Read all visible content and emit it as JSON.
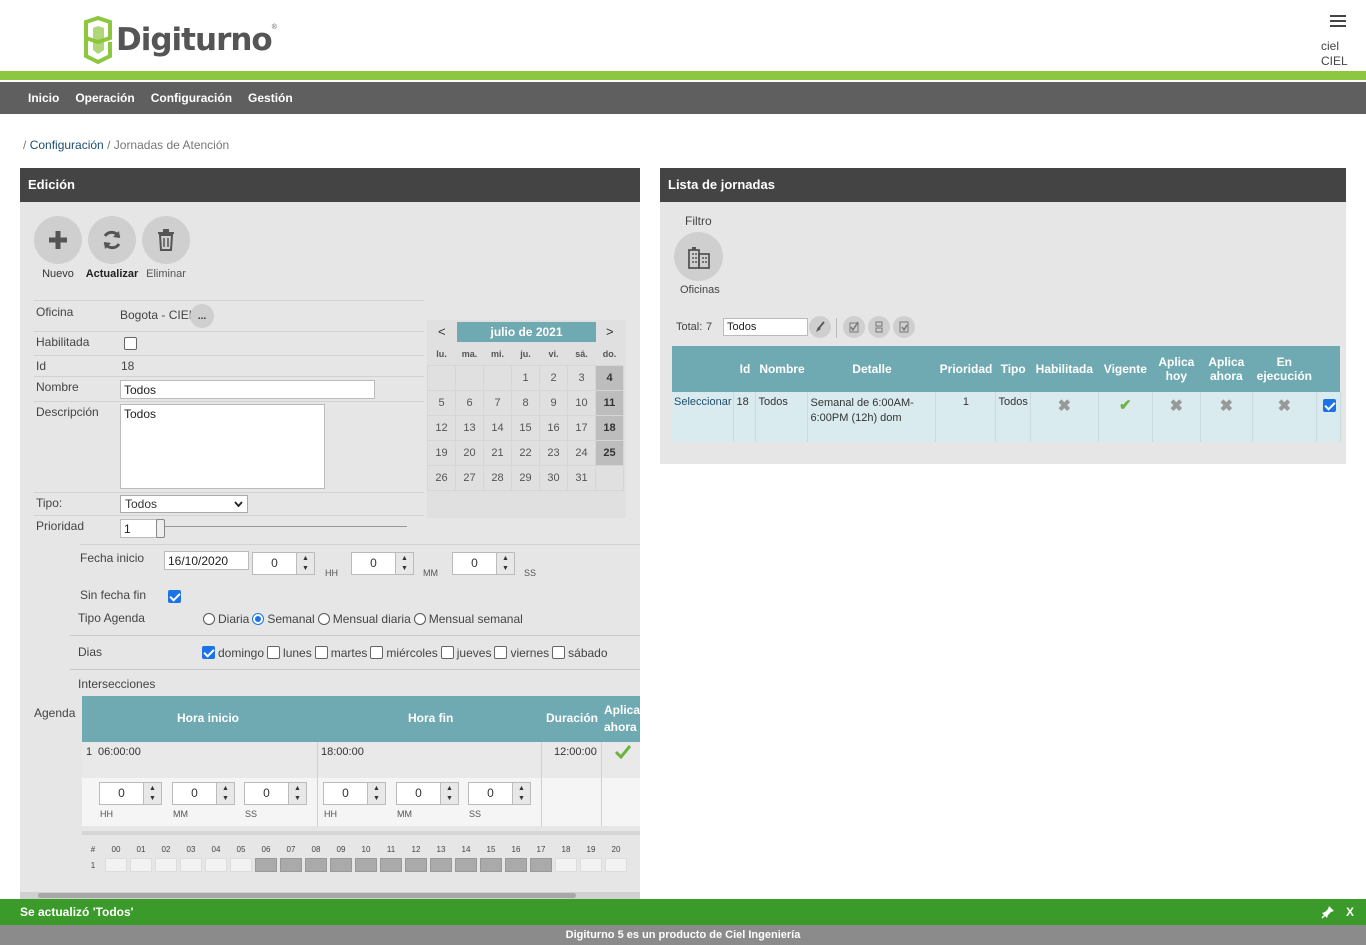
{
  "app": {
    "logo_text": "Digiturno",
    "logo_mark": "®"
  },
  "user": {
    "short": "ciel",
    "long": "CIEL"
  },
  "nav": {
    "items": [
      "Inicio",
      "Operación",
      "Configuración",
      "Gestión"
    ]
  },
  "breadcrumb": {
    "sep": "/",
    "parent": "Configuración",
    "current": "Jornadas de Atención"
  },
  "edit": {
    "title": "Edición",
    "buttons": {
      "new": "Nuevo",
      "refresh": "Actualizar",
      "delete": "Eliminar",
      "more": "..."
    },
    "labels": {
      "office": "Oficina",
      "enabled": "Habilitada",
      "id": "Id",
      "name": "Nombre",
      "description": "Descripción",
      "type": "Tipo:",
      "priority": "Prioridad",
      "start_date": "Fecha inicio",
      "no_end_date": "Sin fecha fin",
      "agenda_type": "Tipo Agenda",
      "days": "Dias",
      "intersections": "Intersecciones",
      "agenda": "Agenda"
    },
    "values": {
      "office": "Bogota - CIEL",
      "enabled": false,
      "id": "18",
      "name": "Todos",
      "description": "Todos",
      "type": "Todos",
      "priority": "1",
      "priority_level": 0.0,
      "start_date": "16/10/2020",
      "hh": "0",
      "mm": "0",
      "ss": "0",
      "no_end_date": true
    },
    "time_units": {
      "hh": "HH",
      "mm": "MM",
      "ss": "SS"
    },
    "agenda_types": [
      {
        "label": "Diaria",
        "selected": false
      },
      {
        "label": "Semanal",
        "selected": true
      },
      {
        "label": "Mensual diaria",
        "selected": false
      },
      {
        "label": "Mensual semanal",
        "selected": false
      }
    ],
    "days": [
      {
        "label": "domingo",
        "checked": true
      },
      {
        "label": "lunes",
        "checked": false
      },
      {
        "label": "martes",
        "checked": false
      },
      {
        "label": "miércoles",
        "checked": false
      },
      {
        "label": "jueves",
        "checked": false
      },
      {
        "label": "viernes",
        "checked": false
      },
      {
        "label": "sábado",
        "checked": false
      }
    ],
    "agenda_table": {
      "headers": [
        "Hora inicio",
        "Hora fin",
        "Duración",
        "Aplica ahora"
      ],
      "row": {
        "num": "1",
        "start": "06:00:00",
        "end": "18:00:00",
        "duration": "12:00:00"
      },
      "spinner_values": [
        "0",
        "0",
        "0",
        "0",
        "0",
        "0"
      ]
    },
    "hour_grid": {
      "hash": "#",
      "row_label": "1",
      "hours": [
        "00",
        "01",
        "02",
        "03",
        "04",
        "05",
        "06",
        "07",
        "08",
        "09",
        "10",
        "11",
        "12",
        "13",
        "14",
        "15",
        "16",
        "17",
        "18",
        "19",
        "20"
      ],
      "active_from": 6,
      "active_to": 18
    }
  },
  "calendar": {
    "month": "julio de 2021",
    "prev": "<",
    "next": ">",
    "weekdays": [
      "lu.",
      "ma.",
      "mi.",
      "ju.",
      "vi.",
      "sá.",
      "do."
    ],
    "weeks": [
      [
        "",
        "",
        "",
        "1",
        "2",
        "3",
        "4"
      ],
      [
        "5",
        "6",
        "7",
        "8",
        "9",
        "10",
        "11"
      ],
      [
        "12",
        "13",
        "14",
        "15",
        "16",
        "17",
        "18"
      ],
      [
        "19",
        "20",
        "21",
        "22",
        "23",
        "24",
        "25"
      ],
      [
        "26",
        "27",
        "28",
        "29",
        "30",
        "31",
        ""
      ]
    ]
  },
  "list": {
    "title": "Lista de jornadas",
    "filter_label": "Filtro",
    "offices_label": "Oficinas",
    "total_label": "Total:",
    "total": "7",
    "filter_value": "Todos",
    "headers": [
      "",
      "Id",
      "Nombre",
      "Detalle",
      "Prioridad",
      "Tipo",
      "Habilitada",
      "Vigente",
      "Aplica hoy",
      "Aplica ahora",
      "En ejecución",
      ""
    ],
    "rows": [
      {
        "select": "Seleccionar",
        "id": "18",
        "name": "Todos",
        "detail": "Semanal de 6:00AM-6:00PM (12h) dom",
        "priority": "1",
        "type": "Todos",
        "enabled": false,
        "current": true,
        "today": false,
        "now": false,
        "running": false,
        "checked": true
      }
    ]
  },
  "notification": {
    "text": "Se actualizó 'Todos'",
    "close": "X"
  },
  "footer": {
    "text": "Digiturno 5 es un producto de Ciel Ingeniería"
  },
  "colors": {
    "accent_green": "#8dc63f",
    "nav_bg": "#5f5f5f",
    "table_head": "#6fa9b1",
    "notif_bg": "#3a9a2a"
  }
}
